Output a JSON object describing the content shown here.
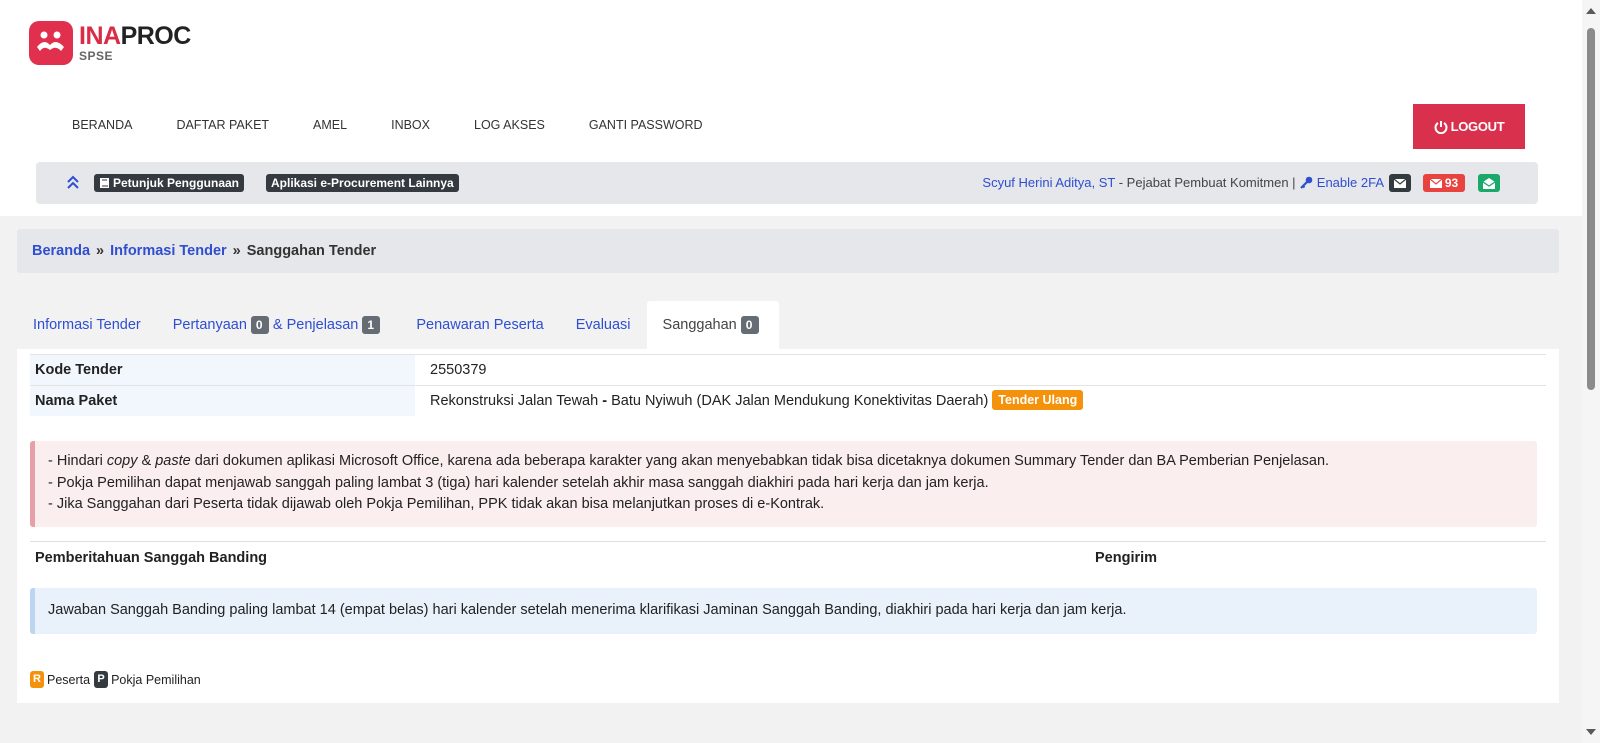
{
  "logo": {
    "ina": "INA",
    "proc": "PROC",
    "sub": "SPSE"
  },
  "nav": [
    {
      "label": "BERANDA"
    },
    {
      "label": "DAFTAR PAKET"
    },
    {
      "label": "AMEL"
    },
    {
      "label": "INBOX"
    },
    {
      "label": "LOG AKSES"
    },
    {
      "label": "GANTI PASSWORD"
    }
  ],
  "logout": {
    "label": "LOGOUT"
  },
  "infobar": {
    "guide_label": "Petunjuk Penggunaan",
    "apps_label": "Aplikasi e-Procurement Lainnya",
    "user_name": "Scyuf Herini Aditya, ST",
    "user_role": " - Pejabat Pembuat Komitmen | ",
    "twofa_label": "Enable 2FA",
    "inbox_count": "93"
  },
  "breadcrumb": {
    "home": "Beranda",
    "sep": "»",
    "info": "Informasi Tender",
    "current": "Sanggahan Tender"
  },
  "tabs": {
    "informasi": "Informasi Tender",
    "pertanyaan": "Pertanyaan",
    "pertanyaan_count": "0",
    "penjelasan": "& Penjelasan",
    "penjelasan_count": "1",
    "penawaran": "Penawaran Peserta",
    "evaluasi": "Evaluasi",
    "sanggahan": "Sanggahan",
    "sanggahan_count": "0"
  },
  "info": {
    "kode_label": "Kode Tender",
    "kode_value": "2550379",
    "nama_label": "Nama Paket",
    "nama_value_a": "Rekonstruksi Jalan Tewah ",
    "nama_value_dash": "-",
    "nama_value_b": " Batu Nyiwuh (DAK Jalan Mendukung Konektivitas Daerah)",
    "tag": "Tender Ulang"
  },
  "notice": {
    "l1_a": "- Hindari ",
    "l1_copy": "copy",
    "l1_b": " & ",
    "l1_paste": "paste",
    "l1_c": " dari dokumen aplikasi Microsoft Office, karena ada beberapa karakter yang akan menyebabkan tidak bisa dicetaknya dokumen Summary Tender dan BA Pemberian Penjelasan.",
    "l2": "- Pokja Pemilihan dapat menjawab sanggah paling lambat 3 (tiga) hari kalender setelah akhir masa sanggah diakhiri pada hari kerja dan jam kerja.",
    "l3": "- Jika Sanggahan dari Peserta tidak dijawab oleh Pokja Pemilihan, PPK tidak akan bisa melanjutkan proses di e-Kontrak."
  },
  "table": {
    "col_notice": "Pemberitahuan Sanggah Banding",
    "col_sender": "Pengirim"
  },
  "banding_info": "Jawaban Sanggah Banding paling lambat 14 (empat belas) hari kalender setelah menerima klarifikasi Jaminan Sanggah Banding, diakhiri pada hari kerja dan jam kerja.",
  "legend": {
    "r_badge": "R",
    "r_label": "Peserta",
    "p_badge": "P",
    "p_label": "Pokja Pemilihan"
  },
  "colors": {
    "brand_red": "#d9304e",
    "link_blue": "#2f4ed0",
    "tag_orange": "#f5920c",
    "badge_green": "#1aa86b"
  }
}
